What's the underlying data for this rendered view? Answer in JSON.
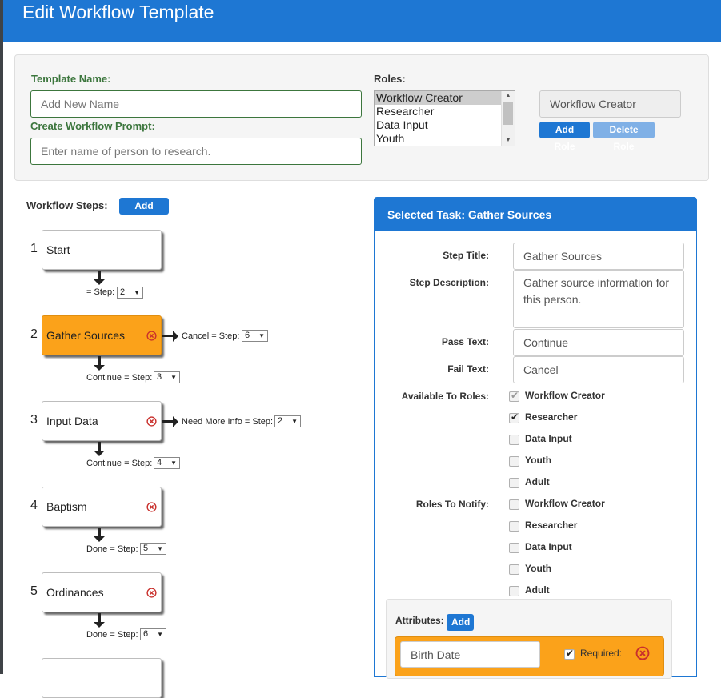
{
  "window": {
    "title": "Edit Workflow Template"
  },
  "template": {
    "name_label": "Template Name:",
    "name_placeholder": "Add New Name",
    "prompt_label": "Create Workflow Prompt:",
    "prompt_placeholder": "Enter name of person to research."
  },
  "roles": {
    "label": "Roles:",
    "options": [
      "Workflow Creator",
      "Researcher",
      "Data Input",
      "Youth"
    ],
    "selected": "Workflow Creator",
    "selected_display": "Workflow Creator",
    "add_label": "Add Role",
    "delete_label": "Delete Role"
  },
  "steps": {
    "label": "Workflow Steps:",
    "add_label": "Add Step",
    "items": [
      {
        "num": "1",
        "title": "Start",
        "down_text": "= Step:",
        "down_value": "2"
      },
      {
        "num": "2",
        "title": "Gather Sources",
        "active": true,
        "side_text": "Cancel = Step:",
        "side_value": "6",
        "down_text": "Continue = Step:",
        "down_value": "3"
      },
      {
        "num": "3",
        "title": "Input Data",
        "side_text": "Need More Info = Step:",
        "side_value": "2",
        "down_text": "Continue = Step:",
        "down_value": "4"
      },
      {
        "num": "4",
        "title": "Baptism",
        "down_text": "Done = Step:",
        "down_value": "5"
      },
      {
        "num": "5",
        "title": "Ordinances",
        "down_text": "Done = Step:",
        "down_value": "6"
      }
    ]
  },
  "task": {
    "header": "Selected Task: Gather Sources",
    "step_title_label": "Step Title:",
    "step_title_value": "Gather Sources",
    "description_label": "Step Description:",
    "description_value": "Gather source information for this person.",
    "pass_label": "Pass Text:",
    "pass_value": "Continue",
    "fail_label": "Fail Text:",
    "fail_value": "Cancel",
    "available_label": "Available To Roles:",
    "available_roles": [
      {
        "name": "Workflow Creator",
        "checked": true,
        "disabled": true
      },
      {
        "name": "Researcher",
        "checked": true
      },
      {
        "name": "Data Input",
        "checked": false
      },
      {
        "name": "Youth",
        "checked": false
      },
      {
        "name": "Adult",
        "checked": false
      }
    ],
    "notify_label": "Roles To Notify:",
    "notify_roles": [
      {
        "name": "Workflow Creator",
        "checked": false
      },
      {
        "name": "Researcher",
        "checked": false
      },
      {
        "name": "Data Input",
        "checked": false
      },
      {
        "name": "Youth",
        "checked": false
      },
      {
        "name": "Adult",
        "checked": false
      }
    ],
    "attributes_label": "Attributes:",
    "attributes_add_label": "Add",
    "attribute": {
      "name": "Birth Date",
      "required_label": "Required:",
      "required": true
    }
  },
  "icons": {
    "remove": "remove-circle-icon",
    "checkmark": "checkmark-icon",
    "dropdown": "dropdown-arrow-icon"
  },
  "colors": {
    "primary": "#1e77d3",
    "active_step": "#fba21a",
    "label_green": "#3c763d",
    "remove_icon": "#c9302c"
  }
}
